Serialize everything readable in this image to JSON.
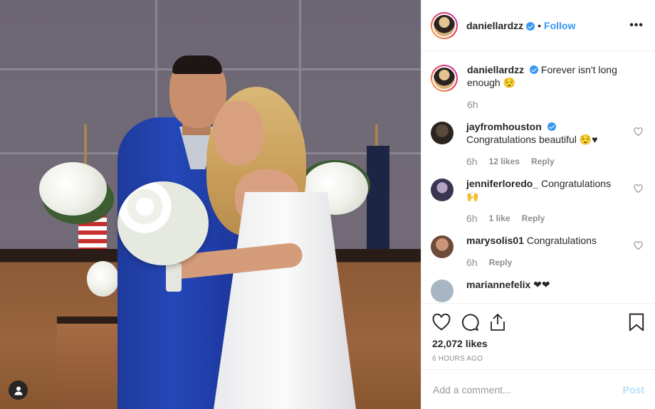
{
  "post": {
    "author": "daniellardzz",
    "follow_label": "Follow",
    "dot": "•",
    "more": "•••"
  },
  "caption": {
    "user": "daniellardzz",
    "text": "Forever isn't long enough 😌",
    "time": "6h"
  },
  "comments": [
    {
      "user": "jayfromhouston",
      "verified": true,
      "text": "Congratulations beautiful 😌♥",
      "time": "6h",
      "likes": "12 likes",
      "reply": "Reply"
    },
    {
      "user": "jenniferloredo_",
      "verified": false,
      "text": "Congratulations 🙌",
      "time": "6h",
      "likes": "1 like",
      "reply": "Reply"
    },
    {
      "user": "marysolis01",
      "verified": false,
      "text": "Congratulations",
      "time": "6h",
      "likes": "",
      "reply": "Reply"
    },
    {
      "user": "mariannefelix",
      "verified": false,
      "text": "❤❤",
      "time": "",
      "likes": "",
      "reply": ""
    }
  ],
  "engagement": {
    "likes": "22,072 likes",
    "posted": "6 HOURS AGO"
  },
  "composer": {
    "placeholder": "Add a comment...",
    "post_label": "Post"
  },
  "icons": {
    "heart": "heart-icon",
    "comment": "comment-icon",
    "share": "share-icon",
    "save": "bookmark-icon",
    "user": "user-icon"
  },
  "colors": {
    "accent": "#3897f0",
    "post_disabled": "#b2dffc",
    "muted": "#8e8e8e"
  }
}
